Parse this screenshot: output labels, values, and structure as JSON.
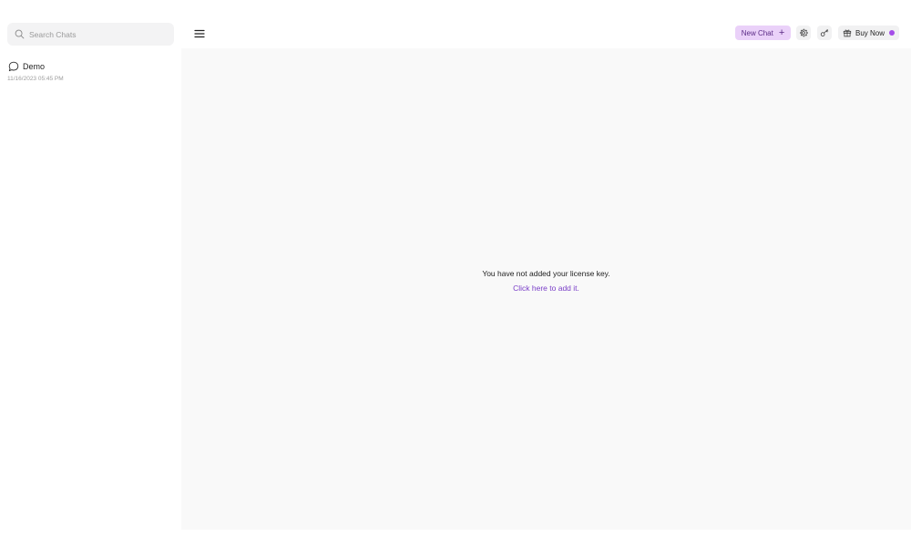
{
  "sidebar": {
    "search": {
      "placeholder": "Search Chats",
      "value": ""
    },
    "chats": [
      {
        "title": "Demo",
        "date": "11/16/2023 05:45 PM"
      }
    ]
  },
  "toolbar": {
    "new_chat_label": "New Chat",
    "new_chat_plus": "+",
    "buy_now_label": "Buy Now"
  },
  "main": {
    "notice_text": "You have not added your license key.",
    "notice_link": "Click here to add it."
  },
  "colors": {
    "accent": "#a44de8",
    "new_chat_bg": "#ead1f9",
    "link": "#7a3fc8",
    "content_bg": "#f9f9f9"
  },
  "icons": {
    "search": "search-icon",
    "chat": "chat-bubble-icon",
    "menu": "hamburger-menu-icon",
    "settings": "gear-icon",
    "key": "key-icon",
    "gift": "gift-icon"
  }
}
